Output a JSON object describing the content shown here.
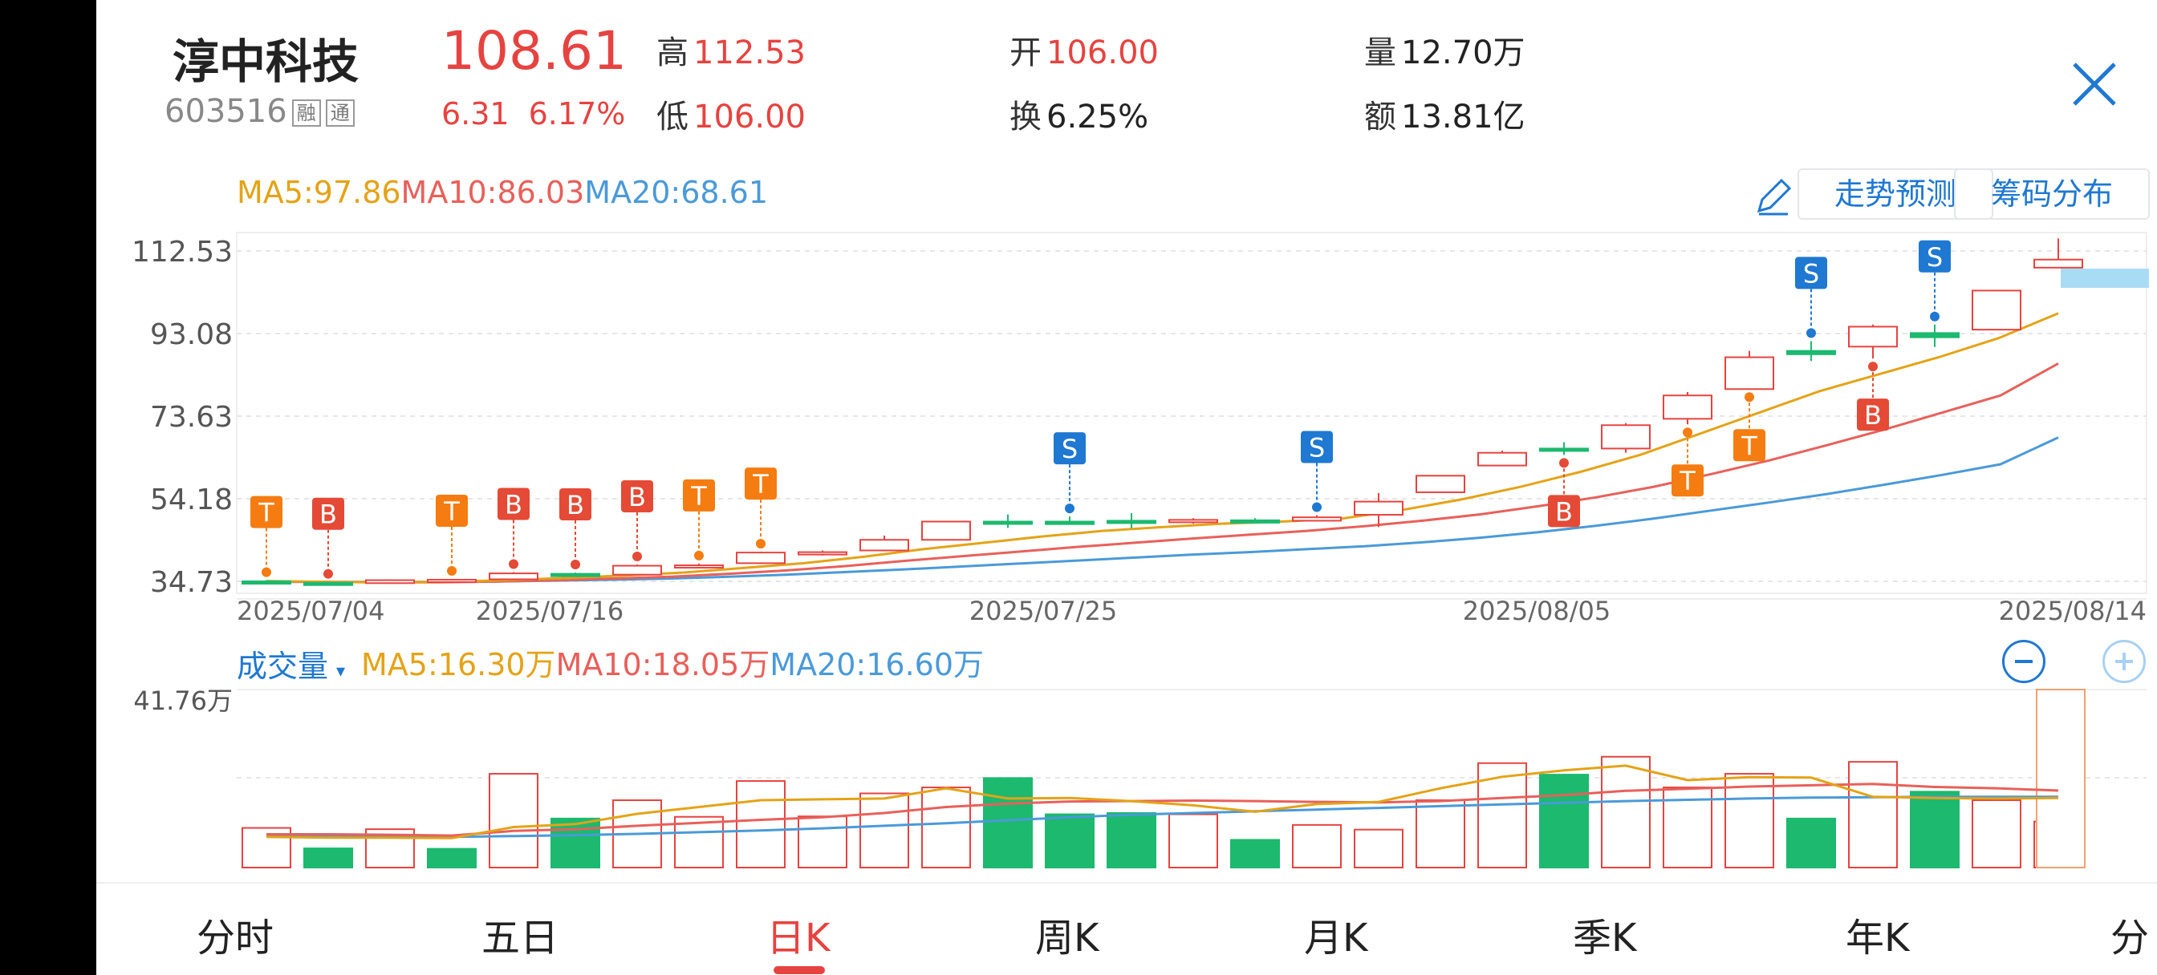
{
  "stock": {
    "name": "淳中科技",
    "code": "603516",
    "badge1": "融",
    "badge2": "通",
    "price": "108.61",
    "change": "6.31",
    "change_pct": "6.17%"
  },
  "quote": {
    "high_label": "高",
    "high": "112.53",
    "low_label": "低",
    "low": "106.00",
    "open_label": "开",
    "open": "106.00",
    "turnover_label": "换",
    "turnover": "6.25%",
    "volume_label": "量",
    "volume": "12.70万",
    "amount_label": "额",
    "amount": "13.81亿"
  },
  "ma": {
    "ma5": "MA5:97.86",
    "ma10": "MA10:86.03",
    "ma20": "MA20:68.61"
  },
  "buttons": {
    "trend": "走势预测",
    "chips": "筹码分布"
  },
  "volume_header": {
    "title": "成交量",
    "arrow": "▾",
    "ma5": "MA5:16.30万",
    "ma10": "MA10:18.05万",
    "ma20": "MA20:16.60万",
    "max_label": "41.76万"
  },
  "colors": {
    "up": "#e64340",
    "down": "#1cb96f",
    "ma5": "#e4a317",
    "ma10": "#e8605b",
    "ma20": "#4a9ad8",
    "accent": "#1f78d1"
  },
  "tabs": [
    "分时",
    "五日",
    "日K",
    "周K",
    "月K",
    "季K",
    "年K",
    "分"
  ],
  "active_tab": 2,
  "chart_data": [
    {
      "type": "candlestick",
      "y_ticks": [
        "112.53",
        "93.08",
        "73.63",
        "54.18",
        "34.73"
      ],
      "x_labels": [
        "2025/07/04",
        "2025/07/16",
        "2025/07/25",
        "2025/08/05",
        "2025/08/14"
      ],
      "ylim": [
        34.73,
        112.53
      ],
      "candles": [
        {
          "o": 34.73,
          "c": 34.4,
          "h": 35,
          "l": 34.3
        },
        {
          "o": 34.4,
          "c": 34.2,
          "h": 34.6,
          "l": 34
        },
        {
          "o": 34.3,
          "c": 35.0,
          "h": 35.2,
          "l": 34.2
        },
        {
          "o": 35.0,
          "c": 35.1,
          "h": 35.3,
          "l": 34.9
        },
        {
          "o": 35.2,
          "c": 36.6,
          "h": 36.9,
          "l": 35.2
        },
        {
          "o": 36.5,
          "c": 36.3,
          "h": 36.8,
          "l": 35.9
        },
        {
          "o": 36.3,
          "c": 38.4,
          "h": 38.7,
          "l": 36.1
        },
        {
          "o": 38.4,
          "c": 38.5,
          "h": 38.9,
          "l": 38.0
        },
        {
          "o": 39.0,
          "c": 41.5,
          "h": 41.7,
          "l": 38.8
        },
        {
          "o": 41.5,
          "c": 41.6,
          "h": 42.0,
          "l": 40.8
        },
        {
          "o": 42.0,
          "c": 44.5,
          "h": 45.5,
          "l": 41.8
        },
        {
          "o": 44.5,
          "c": 48.8,
          "h": 48.8,
          "l": 44.5
        },
        {
          "o": 48.8,
          "c": 48.7,
          "h": 50.5,
          "l": 47.3
        },
        {
          "o": 48.8,
          "c": 48.2,
          "h": 50.0,
          "l": 48.2
        },
        {
          "o": 49.0,
          "c": 48.7,
          "h": 50.8,
          "l": 47.2
        },
        {
          "o": 48.7,
          "c": 49.2,
          "h": 49.6,
          "l": 48.3
        },
        {
          "o": 49.1,
          "c": 48.9,
          "h": 49.6,
          "l": 48.4
        },
        {
          "o": 49.0,
          "c": 49.8,
          "h": 50.3,
          "l": 48.8
        },
        {
          "o": 50.4,
          "c": 53.5,
          "h": 55.5,
          "l": 47.5
        },
        {
          "o": 55.7,
          "c": 59.6,
          "h": 59.6,
          "l": 55.7
        },
        {
          "o": 62.0,
          "c": 65.0,
          "h": 65.5,
          "l": 62.0
        },
        {
          "o": 66.0,
          "c": 65.5,
          "h": 67.5,
          "l": 64.5
        },
        {
          "o": 66.0,
          "c": 71.5,
          "h": 72.0,
          "l": 65.0
        },
        {
          "o": 73.0,
          "c": 78.5,
          "h": 79.3,
          "l": 71.7
        },
        {
          "o": 80.0,
          "c": 87.5,
          "h": 89.0,
          "l": 80.0
        },
        {
          "o": 89.0,
          "c": 88.2,
          "h": 91.3,
          "l": 86.6
        },
        {
          "o": 90.0,
          "c": 94.7,
          "h": 95.2,
          "l": 87.2
        },
        {
          "o": 93.2,
          "c": 92.2,
          "h": 95.2,
          "l": 89.9
        },
        {
          "o": 94.0,
          "c": 103.2,
          "h": 103.2,
          "l": 94.0
        },
        {
          "o": 108.6,
          "c": 110.5,
          "h": 115.5,
          "l": 108.6
        }
      ],
      "ma5": [
        34.8,
        34.6,
        34.5,
        34.6,
        35.0,
        35.5,
        36.1,
        36.8,
        37.9,
        39.0,
        40.5,
        42.3,
        43.8,
        45.3,
        46.6,
        47.5,
        48.3,
        48.8,
        49.5,
        51.5,
        54.0,
        57.0,
        60.5,
        64.5,
        69.5,
        74.5,
        79.5,
        83.5,
        87.5,
        92.0,
        97.86
      ],
      "ma10": [
        34.7,
        34.6,
        34.5,
        34.5,
        34.7,
        35.0,
        35.4,
        35.8,
        36.5,
        37.3,
        38.3,
        39.5,
        40.6,
        41.7,
        42.8,
        43.8,
        44.8,
        45.7,
        46.6,
        47.7,
        49.0,
        50.5,
        52.4,
        54.5,
        57.0,
        60.0,
        63.2,
        66.8,
        70.5,
        74.5,
        78.5,
        86.03
      ],
      "ma20": [
        34.6,
        34.6,
        34.6,
        34.6,
        34.7,
        34.9,
        35.1,
        35.4,
        35.8,
        36.3,
        36.9,
        37.5,
        38.2,
        38.9,
        39.6,
        40.3,
        41.0,
        41.6,
        42.3,
        43.0,
        43.9,
        45.0,
        46.3,
        47.8,
        49.5,
        51.4,
        53.3,
        55.3,
        57.5,
        59.8,
        62.3,
        68.61
      ],
      "markers": [
        {
          "i": 0,
          "t": "T",
          "kind": "orange",
          "up": true
        },
        {
          "i": 1,
          "t": "B",
          "kind": "red",
          "up": true
        },
        {
          "i": 3,
          "t": "T",
          "kind": "orange",
          "up": true
        },
        {
          "i": 4,
          "t": "B",
          "kind": "red",
          "up": true
        },
        {
          "i": 5,
          "t": "B",
          "kind": "red",
          "up": true
        },
        {
          "i": 6,
          "t": "B",
          "kind": "red",
          "up": true
        },
        {
          "i": 7,
          "t": "T",
          "kind": "orange",
          "up": true
        },
        {
          "i": 8,
          "t": "T",
          "kind": "orange",
          "up": true
        },
        {
          "i": 13,
          "t": "S",
          "kind": "blue",
          "up": true
        },
        {
          "i": 17,
          "t": "S",
          "kind": "blue",
          "up": true
        },
        {
          "i": 21,
          "t": "B",
          "kind": "red",
          "up": false
        },
        {
          "i": 23,
          "t": "T",
          "kind": "orange",
          "up": false
        },
        {
          "i": 24,
          "t": "T",
          "kind": "orange",
          "up": false
        },
        {
          "i": 25,
          "t": "S",
          "kind": "blue",
          "up": true
        },
        {
          "i": 26,
          "t": "B",
          "kind": "red",
          "up": false
        },
        {
          "i": 27,
          "t": "S",
          "kind": "blue",
          "up": true
        }
      ]
    },
    {
      "type": "bar",
      "max": 41.76,
      "max_label": "41.76万",
      "volumes": [
        9.3,
        4.5,
        9.0,
        4.4,
        22,
        11.5,
        15.8,
        11.9,
        20.3,
        12.0,
        17.4,
        18.8,
        21,
        12.5,
        12.8,
        12.5,
        6.5,
        10.0,
        8.9,
        15.8,
        24.5,
        21.8,
        26,
        18.8,
        22,
        11.5,
        24.8,
        17.8,
        15.8,
        10.8,
        41.76
      ],
      "directions": [
        "u",
        "d",
        "u",
        "d",
        "u",
        "d",
        "u",
        "u",
        "u",
        "u",
        "u",
        "u",
        "d",
        "d",
        "d",
        "u",
        "d",
        "u",
        "u",
        "u",
        "u",
        "d",
        "u",
        "u",
        "u",
        "d",
        "u",
        "d",
        "u",
        "u",
        "u"
      ],
      "ma5": [
        7.2,
        7.0,
        7.0,
        6.9,
        9.5,
        10.2,
        12.6,
        14.2,
        15.8,
        16.0,
        16.2,
        18.6,
        16.2,
        16.3,
        15.6,
        14.6,
        13.1,
        14.9,
        15.4,
        18.6,
        21.3,
        22.8,
        23.9,
        20.5,
        21.2,
        21.1,
        16.6,
        16.3,
        16.2,
        16.3
      ],
      "ma10": [
        7.8,
        7.8,
        7.7,
        7.5,
        8.6,
        9.0,
        9.8,
        10.5,
        11.2,
        11.8,
        12.8,
        14.2,
        15.0,
        15.5,
        15.6,
        15.7,
        15.6,
        15.4,
        15.3,
        15.6,
        16.3,
        17.0,
        18.0,
        18.5,
        19.0,
        19.3,
        19.6,
        18.9,
        18.6,
        18.05
      ],
      "ma20": [
        7.3,
        7.3,
        7.3,
        7.2,
        7.4,
        7.6,
        7.9,
        8.3,
        8.7,
        9.2,
        9.8,
        10.4,
        11.1,
        11.8,
        12.4,
        12.8,
        13.2,
        13.6,
        14.0,
        14.4,
        14.8,
        15.2,
        15.6,
        15.9,
        16.2,
        16.4,
        16.5,
        16.6,
        16.6,
        16.6
      ]
    }
  ]
}
